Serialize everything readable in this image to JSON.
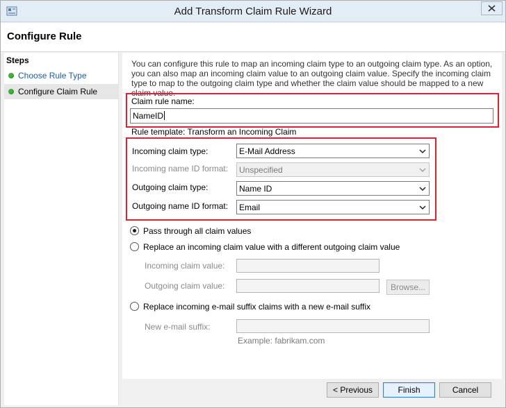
{
  "window": {
    "title": "Add Transform Claim Rule Wizard"
  },
  "header": {
    "page_title": "Configure Rule"
  },
  "steps": {
    "title": "Steps",
    "items": [
      {
        "label": "Choose Rule Type",
        "state": "link"
      },
      {
        "label": "Configure Claim Rule",
        "state": "active"
      }
    ]
  },
  "main": {
    "description": "You can configure this rule to map an incoming claim type to an outgoing claim type. As an option, you can also map an incoming claim value to an outgoing claim value. Specify the incoming claim type to map to the outgoing claim type and whether the claim value should be mapped to a new claim value.",
    "claim_rule_name": {
      "label": "Claim rule name:",
      "value": "NameID"
    },
    "rule_template": "Rule template: Transform an Incoming Claim",
    "incoming_claim_type": {
      "label": "Incoming claim type:",
      "value": "E-Mail Address"
    },
    "incoming_name_id_format": {
      "label": "Incoming name ID format:",
      "value": "Unspecified",
      "enabled": false
    },
    "outgoing_claim_type": {
      "label": "Outgoing claim type:",
      "value": "Name ID"
    },
    "outgoing_name_id_format": {
      "label": "Outgoing name ID format:",
      "value": "Email"
    },
    "options": {
      "pass_through": {
        "label": "Pass through all claim values",
        "selected": true
      },
      "replace_value": {
        "label": "Replace an incoming claim value with a different outgoing claim value",
        "selected": false
      },
      "incoming_claim_value_label": "Incoming claim value:",
      "outgoing_claim_value_label": "Outgoing claim value:",
      "browse_label": "Browse...",
      "replace_suffix": {
        "label": "Replace incoming e-mail suffix claims with a new e-mail suffix",
        "selected": false
      },
      "new_suffix_label": "New e-mail suffix:",
      "example_text": "Example: fabrikam.com"
    }
  },
  "footer": {
    "previous_label": "< Previous",
    "finish_label": "Finish",
    "cancel_label": "Cancel"
  },
  "colors": {
    "highlight_box": "#e0202a",
    "step_dot": "#3fb23a",
    "link": "#1c5ba6"
  }
}
